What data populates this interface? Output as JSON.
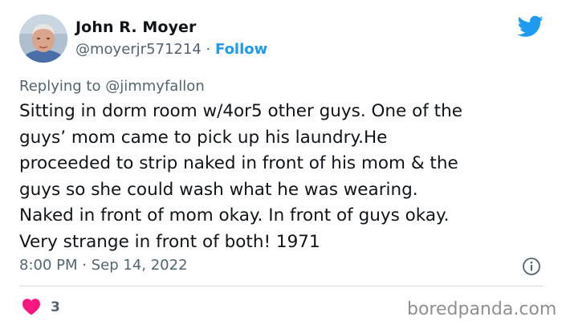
{
  "author": {
    "name": "John R. Moyer",
    "handle": "@moyerjr571214",
    "separator": "·",
    "follow_label": "Follow"
  },
  "reply": {
    "prefix": "Replying to",
    "handle": "@jimmyfallon"
  },
  "tweet": {
    "lines": [
      "Sitting in dorm room w/4or5 other guys. One of the",
      "guys’ mom came to pick up his laundry.He",
      "proceeded to strip naked in front of his mom & the",
      "guys so she could wash what he was wearing.",
      "Naked in front of mom okay. In front of guys okay.",
      "Very strange in front of both!  1971"
    ],
    "time": "8:00 PM",
    "separator": "·",
    "date": "Sep 14, 2022"
  },
  "engagement": {
    "likes": "3"
  },
  "watermark": "boredpanda.com",
  "icons": {
    "logo": "twitter-bird-icon",
    "info": "info-icon",
    "like": "heart-icon"
  },
  "colors": {
    "accent": "#1d9bf0",
    "heart": "#f91880",
    "secondary_text": "#536471",
    "primary_text": "#0f1419",
    "divider": "#cfd9de",
    "watermark": "#8f8f8f"
  }
}
